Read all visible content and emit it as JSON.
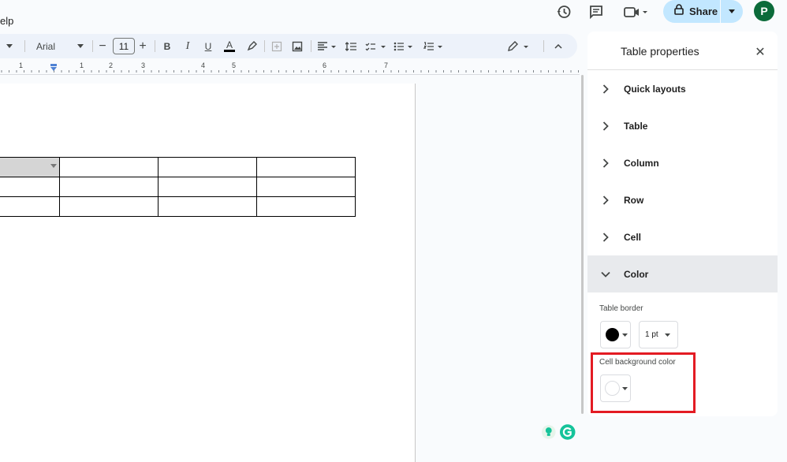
{
  "topbar": {
    "menu_partial": "elp",
    "share_label": "Share",
    "avatar_letter": "P",
    "icons": [
      "history-icon",
      "comment-icon",
      "video-call-icon",
      "lock-icon"
    ]
  },
  "toolbar": {
    "font_name": "Arial",
    "font_size": "11",
    "decrease_label": "−",
    "increase_label": "+",
    "bold_label": "B",
    "italic_label": "I",
    "underline_label": "U",
    "text_color_label": "A"
  },
  "ruler": {
    "numbers": [
      "1",
      "1",
      "2",
      "3",
      "4",
      "5",
      "6",
      "7"
    ]
  },
  "document": {
    "table": {
      "rows": 3,
      "cols": 4,
      "selected_cell": "row 1, col 1"
    }
  },
  "panel": {
    "title": "Table properties",
    "close_label": "✕",
    "sections": [
      {
        "label": "Quick layouts",
        "expanded": false
      },
      {
        "label": "Table",
        "expanded": false
      },
      {
        "label": "Column",
        "expanded": false
      },
      {
        "label": "Row",
        "expanded": false
      },
      {
        "label": "Cell",
        "expanded": false
      },
      {
        "label": "Color",
        "expanded": true
      }
    ],
    "color": {
      "table_border_label": "Table border",
      "border_color": "#000000",
      "border_width": "1 pt",
      "cell_bg_label": "Cell background color",
      "cell_bg_color": "#ffffff"
    }
  },
  "colors": {
    "accent_share": "#c2e7ff",
    "avatar_bg": "#0b6b3a",
    "highlight": "#e31b23",
    "selected_cell": "#d5d5d5"
  }
}
